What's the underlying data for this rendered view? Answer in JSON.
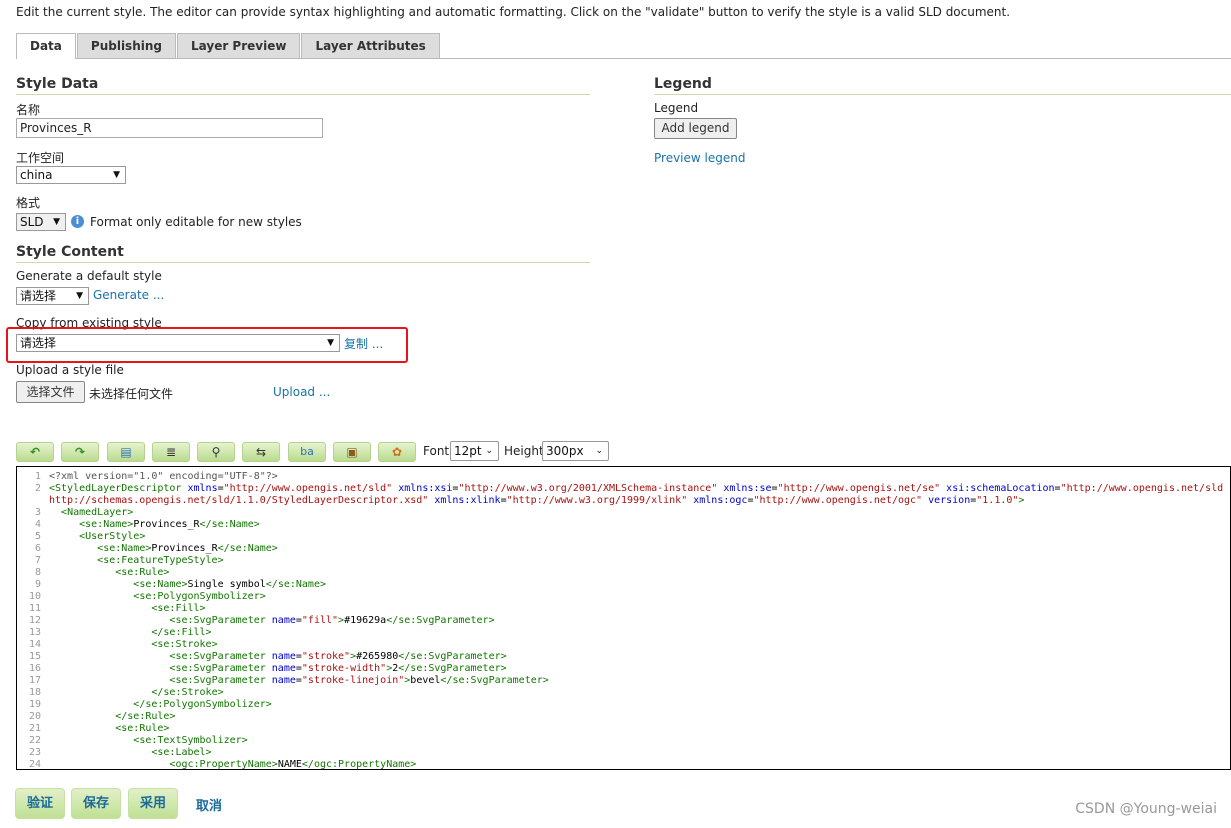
{
  "intro": "Edit the current style. The editor can provide syntax highlighting and automatic formatting. Click on the \"validate\" button to verify the style is a valid SLD document.",
  "tabs": [
    {
      "label": "Data",
      "active": true
    },
    {
      "label": "Publishing"
    },
    {
      "label": "Layer Preview"
    },
    {
      "label": "Layer Attributes"
    }
  ],
  "style_data": {
    "heading": "Style Data",
    "name_label": "名称",
    "name_value": "Provinces_R",
    "workspace_label": "工作空间",
    "workspace_value": "china",
    "format_label": "格式",
    "format_value": "SLD",
    "format_note": "Format only editable for new styles"
  },
  "style_content": {
    "heading": "Style Content",
    "generate_label": "Generate a default style",
    "generate_select": "请选择",
    "generate_link": "Generate ...",
    "copy_label": "Copy from existing style",
    "copy_select": "请选择",
    "copy_link": "复制 ...",
    "upload_label": "Upload a style file",
    "choose_file": "选择文件",
    "no_file": "未选择任何文件",
    "upload_link": "Upload ..."
  },
  "legend": {
    "heading": "Legend",
    "label": "Legend",
    "add_button": "Add legend",
    "preview_link": "Preview legend"
  },
  "toolbar": {
    "icons": [
      "undo-icon",
      "redo-icon",
      "goto-line-icon",
      "reindent-icon",
      "find-icon",
      "find-replace-icon",
      "toggle-highlight-icon",
      "image-icon",
      "color-picker-icon"
    ],
    "font_label": "Font",
    "font_value": "12pt",
    "height_label": "Height",
    "height_value": "300px"
  },
  "code_lines": [
    "<?xml version=\"1.0\" encoding=\"UTF-8\"?>",
    "<StyledLayerDescriptor xmlns=\"http://www.opengis.net/sld\" xmlns:xsi=\"http://www.w3.org/2001/XMLSchema-instance\" xmlns:se=\"http://www.opengis.net/se\" xsi:schemaLocation=\"http://www.opengis.net/sld http://schemas.opengis.net/sld/1.1.0/StyledLayerDescriptor.xsd\" xmlns:xlink=\"http://www.w3.org/1999/xlink\" xmlns:ogc=\"http://www.opengis.net/ogc\" version=\"1.1.0\">",
    "  <NamedLayer>",
    "     <se:Name>Provinces_R</se:Name>",
    "     <UserStyle>",
    "        <se:Name>Provinces_R</se:Name>",
    "        <se:FeatureTypeStyle>",
    "           <se:Rule>",
    "              <se:Name>Single symbol</se:Name>",
    "              <se:PolygonSymbolizer>",
    "                 <se:Fill>",
    "                    <se:SvgParameter name=\"fill\">#19629a</se:SvgParameter>",
    "                 </se:Fill>",
    "                 <se:Stroke>",
    "                    <se:SvgParameter name=\"stroke\">#265980</se:SvgParameter>",
    "                    <se:SvgParameter name=\"stroke-width\">2</se:SvgParameter>",
    "                    <se:SvgParameter name=\"stroke-linejoin\">bevel</se:SvgParameter>",
    "                 </se:Stroke>",
    "              </se:PolygonSymbolizer>",
    "           </se:Rule>",
    "           <se:Rule>",
    "              <se:TextSymbolizer>",
    "                 <se:Label>",
    "                    <ogc:PropertyName>NAME</ogc:PropertyName>"
  ],
  "actions": {
    "validate": "验证",
    "save": "保存",
    "apply": "采用",
    "cancel": "取消"
  },
  "watermark": "CSDN @Young-weiai",
  "highlight_color": "#e8141b"
}
